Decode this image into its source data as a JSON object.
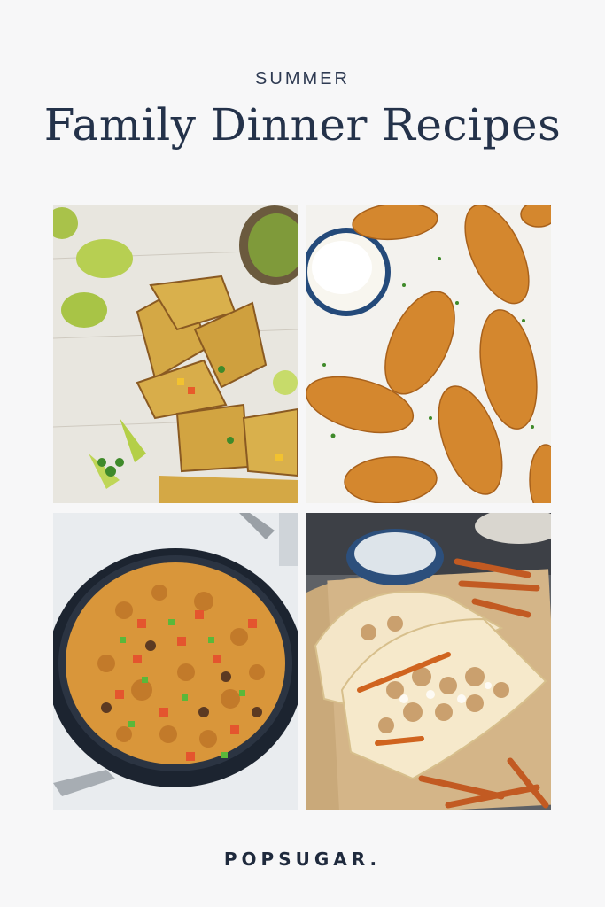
{
  "header": {
    "eyebrow": "SUMMER",
    "title": "Family Dinner Recipes"
  },
  "photos": [
    {
      "subject": "quesadillas-with-guacamole-and-limes"
    },
    {
      "subject": "baked-chicken-tenders-with-dip"
    },
    {
      "subject": "taco-pasta-skillet"
    },
    {
      "subject": "chicken-gyros-with-sweet-potato-fries"
    }
  ],
  "footer": {
    "brand": "POPSUGAR."
  }
}
